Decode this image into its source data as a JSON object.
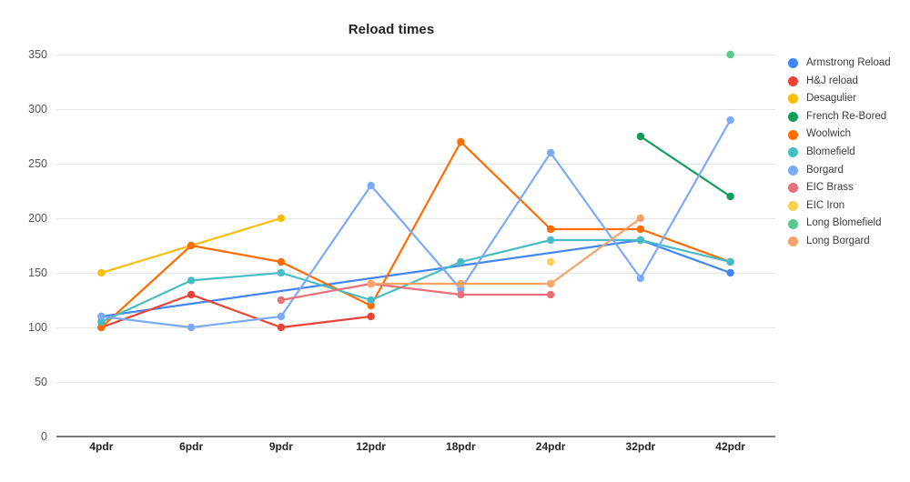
{
  "chart_data": {
    "type": "line",
    "title": "Reload times",
    "xlabel": "",
    "ylabel": "",
    "categories": [
      "4pdr",
      "6pdr",
      "9pdr",
      "12pdr",
      "18pdr",
      "24pdr",
      "32pdr",
      "42pdr"
    ],
    "ylim": [
      0,
      350
    ],
    "yticks": [
      0,
      50,
      100,
      150,
      200,
      250,
      300,
      350
    ],
    "ytick_labels": [
      "0",
      "50",
      "100",
      "150",
      "200",
      "250",
      "300",
      "350"
    ],
    "grid": true,
    "legend_position": "right",
    "markers": true,
    "series": [
      {
        "name": "Armstrong Reload",
        "color": "#4285f4",
        "values": [
          110,
          null,
          null,
          null,
          null,
          null,
          180,
          150
        ]
      },
      {
        "name": "H&J reload",
        "color": "#ea4335",
        "values": [
          100,
          130,
          100,
          110,
          null,
          null,
          null,
          null
        ]
      },
      {
        "name": "Desagulier",
        "color": "#fbbc04",
        "values": [
          150,
          175,
          200,
          null,
          null,
          null,
          null,
          null
        ]
      },
      {
        "name": "French Re-Bored",
        "color": "#0f9d58",
        "values": [
          null,
          null,
          null,
          null,
          null,
          null,
          275,
          220
        ]
      },
      {
        "name": "Woolwich",
        "color": "#ff6d01",
        "values": [
          100,
          175,
          160,
          120,
          270,
          190,
          190,
          160
        ]
      },
      {
        "name": "Blomefield",
        "color": "#46bdc6",
        "values": [
          105,
          143,
          150,
          125,
          160,
          180,
          180,
          160
        ]
      },
      {
        "name": "Borgard",
        "color": "#7baaf7",
        "values": [
          110,
          100,
          110,
          230,
          135,
          260,
          145,
          290
        ]
      },
      {
        "name": "EIC Brass",
        "color": "#e8707a",
        "values": [
          null,
          null,
          125,
          140,
          130,
          130,
          null,
          null
        ]
      },
      {
        "name": "EIC Iron",
        "color": "#fcd04f",
        "values": [
          null,
          null,
          null,
          null,
          null,
          160,
          null,
          null
        ]
      },
      {
        "name": "Long Blomefield",
        "color": "#5bc98d",
        "values": [
          null,
          null,
          null,
          null,
          null,
          null,
          null,
          350
        ]
      },
      {
        "name": "Long Borgard",
        "color": "#f8a268",
        "values": [
          null,
          null,
          null,
          140,
          140,
          140,
          200,
          null
        ]
      }
    ]
  }
}
